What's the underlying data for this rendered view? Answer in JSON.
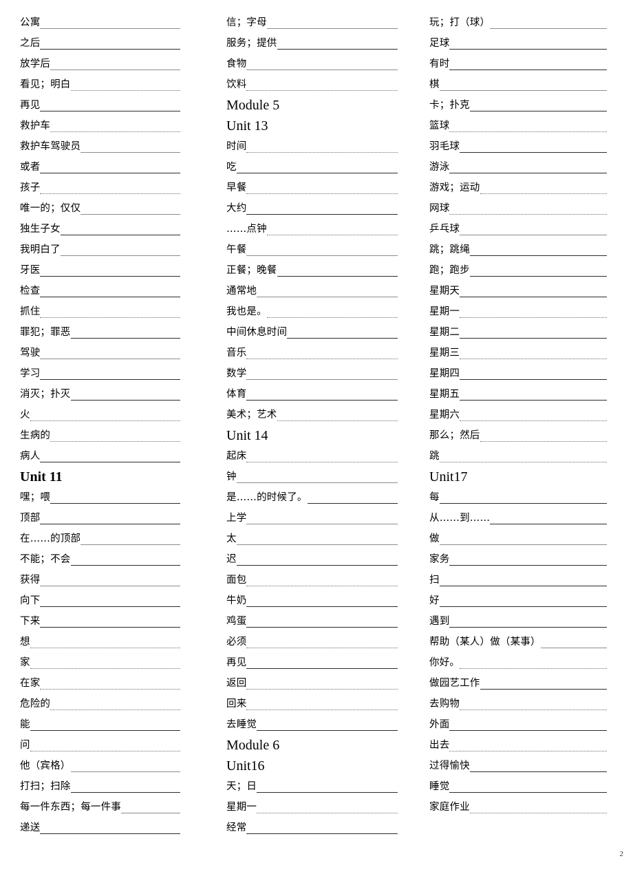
{
  "document": {
    "page_number": "2",
    "type": "vocabulary-worksheet"
  },
  "columns": [
    {
      "id": "column-1",
      "rows": [
        {
          "kind": "entry",
          "gloss": "公寓",
          "rule": "faint"
        },
        {
          "kind": "entry",
          "gloss": "之后",
          "rule": "solid"
        },
        {
          "kind": "entry",
          "gloss": "放学后",
          "rule": "faint"
        },
        {
          "kind": "entry",
          "gloss": "看见；明白",
          "rule": "dotted"
        },
        {
          "kind": "entry",
          "gloss": "再见",
          "rule": "solid"
        },
        {
          "kind": "entry",
          "gloss": "救护车",
          "rule": "dotted"
        },
        {
          "kind": "entry",
          "gloss": "救护车驾驶员",
          "rule": "faint"
        },
        {
          "kind": "entry",
          "gloss": "或者",
          "rule": "solid"
        },
        {
          "kind": "entry",
          "gloss": "孩子",
          "rule": "dotted"
        },
        {
          "kind": "entry",
          "gloss": "唯一的；仅仅",
          "rule": "faint"
        },
        {
          "kind": "entry",
          "gloss": "独生子女",
          "rule": "solid"
        },
        {
          "kind": "entry",
          "gloss": "我明白了",
          "rule": "faint"
        },
        {
          "kind": "entry",
          "gloss": "牙医",
          "rule": "solid"
        },
        {
          "kind": "entry",
          "gloss": "检查",
          "rule": "solid"
        },
        {
          "kind": "entry",
          "gloss": "抓住",
          "rule": "dotted"
        },
        {
          "kind": "entry",
          "gloss": "罪犯；罪恶",
          "rule": "solid"
        },
        {
          "kind": "entry",
          "gloss": "驾驶",
          "rule": "faint"
        },
        {
          "kind": "entry",
          "gloss": "学习",
          "rule": "solid"
        },
        {
          "kind": "entry",
          "gloss": "消灭；扑灭",
          "rule": "solid"
        },
        {
          "kind": "entry",
          "gloss": "火",
          "rule": "dotted"
        },
        {
          "kind": "entry",
          "gloss": "生病的",
          "rule": "dotted"
        },
        {
          "kind": "entry",
          "gloss": "病人",
          "rule": "solid"
        },
        {
          "kind": "heading",
          "text": "Unit 11",
          "bold": true
        },
        {
          "kind": "entry",
          "gloss": "嘿；喂",
          "rule": "solid"
        },
        {
          "kind": "entry",
          "gloss": "顶部",
          "rule": "solid"
        },
        {
          "kind": "entry",
          "gloss": "在……的顶部",
          "rule": "faint"
        },
        {
          "kind": "entry",
          "gloss": "不能；不会",
          "rule": "solid"
        },
        {
          "kind": "entry",
          "gloss": "获得",
          "rule": "faint"
        },
        {
          "kind": "entry",
          "gloss": "向下",
          "rule": "solid"
        },
        {
          "kind": "entry",
          "gloss": "下来",
          "rule": "solid"
        },
        {
          "kind": "entry",
          "gloss": "想",
          "rule": "dotted"
        },
        {
          "kind": "entry",
          "gloss": "家",
          "rule": "dotted"
        },
        {
          "kind": "entry",
          "gloss": "在家",
          "rule": "dotted"
        },
        {
          "kind": "entry",
          "gloss": "危险的",
          "rule": "dotted"
        },
        {
          "kind": "entry",
          "gloss": "能",
          "rule": "solid"
        },
        {
          "kind": "entry",
          "gloss": "问",
          "rule": "dotted"
        },
        {
          "kind": "entry",
          "gloss": "他（宾格）",
          "rule": "faint"
        },
        {
          "kind": "entry",
          "gloss": "打扫；扫除",
          "rule": "solid"
        },
        {
          "kind": "entry",
          "gloss": "每一件东西；每一件事",
          "rule": "faint"
        },
        {
          "kind": "entry",
          "gloss": "递送",
          "rule": "solid"
        }
      ]
    },
    {
      "id": "column-2",
      "rows": [
        {
          "kind": "entry",
          "gloss": "信；字母",
          "rule": "faint"
        },
        {
          "kind": "entry",
          "gloss": "服务；提供",
          "rule": "solid"
        },
        {
          "kind": "entry",
          "gloss": "食物",
          "rule": "faint"
        },
        {
          "kind": "entry",
          "gloss": "饮料",
          "rule": "dotted"
        },
        {
          "kind": "heading",
          "text": "Module 5",
          "bold": false
        },
        {
          "kind": "heading",
          "text": "Unit 13",
          "bold": false
        },
        {
          "kind": "entry",
          "gloss": "时间",
          "rule": "dotted"
        },
        {
          "kind": "entry",
          "gloss": "吃",
          "rule": "solid"
        },
        {
          "kind": "entry",
          "gloss": "早餐",
          "rule": "dotted"
        },
        {
          "kind": "entry",
          "gloss": "大约",
          "rule": "solid"
        },
        {
          "kind": "entry",
          "gloss": "……点钟",
          "rule": "dotted"
        },
        {
          "kind": "entry",
          "gloss": "午餐",
          "rule": "faint"
        },
        {
          "kind": "entry",
          "gloss": "正餐；晚餐",
          "rule": "solid"
        },
        {
          "kind": "entry",
          "gloss": "通常地",
          "rule": "faint"
        },
        {
          "kind": "entry",
          "gloss": "我也是。",
          "rule": "dotted"
        },
        {
          "kind": "entry",
          "gloss": "中间休息时间",
          "rule": "solid"
        },
        {
          "kind": "entry",
          "gloss": "音乐",
          "rule": "dotted"
        },
        {
          "kind": "entry",
          "gloss": "数学",
          "rule": "faint"
        },
        {
          "kind": "entry",
          "gloss": "体育",
          "rule": "solid"
        },
        {
          "kind": "entry",
          "gloss": "美术；艺术",
          "rule": "dotted"
        },
        {
          "kind": "heading",
          "text": "Unit 14",
          "bold": false
        },
        {
          "kind": "entry",
          "gloss": "起床",
          "rule": "dotted"
        },
        {
          "kind": "entry",
          "gloss": "钟",
          "rule": "faint"
        },
        {
          "kind": "entry",
          "gloss": "是……的时候了。",
          "rule": "solid"
        },
        {
          "kind": "entry",
          "gloss": "上学",
          "rule": "faint"
        },
        {
          "kind": "entry",
          "gloss": "太",
          "rule": "faint"
        },
        {
          "kind": "entry",
          "gloss": "迟",
          "rule": "solid"
        },
        {
          "kind": "entry",
          "gloss": "面包",
          "rule": "dotted"
        },
        {
          "kind": "entry",
          "gloss": "牛奶",
          "rule": "solid"
        },
        {
          "kind": "entry",
          "gloss": "鸡蛋",
          "rule": "solid"
        },
        {
          "kind": "entry",
          "gloss": "必须",
          "rule": "dotted"
        },
        {
          "kind": "entry",
          "gloss": "再见",
          "rule": "solid"
        },
        {
          "kind": "entry",
          "gloss": "返回",
          "rule": "dotted"
        },
        {
          "kind": "entry",
          "gloss": "回来",
          "rule": "dotted"
        },
        {
          "kind": "entry",
          "gloss": "去睡觉",
          "rule": "solid"
        },
        {
          "kind": "heading",
          "text": "Module 6",
          "bold": false
        },
        {
          "kind": "heading",
          "text": "Unit16",
          "bold": false
        },
        {
          "kind": "entry",
          "gloss": "天；日",
          "rule": "solid"
        },
        {
          "kind": "entry",
          "gloss": "星期一",
          "rule": "dotted"
        },
        {
          "kind": "entry",
          "gloss": "经常",
          "rule": "solid"
        }
      ]
    },
    {
      "id": "column-3",
      "rows": [
        {
          "kind": "entry",
          "gloss": "玩；打（球）",
          "rule": "faint"
        },
        {
          "kind": "entry",
          "gloss": "足球",
          "rule": "solid"
        },
        {
          "kind": "entry",
          "gloss": "有时",
          "rule": "solid"
        },
        {
          "kind": "entry",
          "gloss": "棋",
          "rule": "faint"
        },
        {
          "kind": "entry",
          "gloss": "卡；扑克",
          "rule": "solid"
        },
        {
          "kind": "entry",
          "gloss": "篮球",
          "rule": "dotted"
        },
        {
          "kind": "entry",
          "gloss": "羽毛球",
          "rule": "solid"
        },
        {
          "kind": "entry",
          "gloss": "游泳",
          "rule": "solid"
        },
        {
          "kind": "entry",
          "gloss": "游戏；运动",
          "rule": "dotted"
        },
        {
          "kind": "entry",
          "gloss": "网球",
          "rule": "dotted"
        },
        {
          "kind": "entry",
          "gloss": "乒乓球",
          "rule": "faint"
        },
        {
          "kind": "entry",
          "gloss": "跳；跳绳",
          "rule": "solid"
        },
        {
          "kind": "entry",
          "gloss": "跑；跑步",
          "rule": "solid"
        },
        {
          "kind": "entry",
          "gloss": "星期天",
          "rule": "solid"
        },
        {
          "kind": "entry",
          "gloss": "星期一",
          "rule": "dotted"
        },
        {
          "kind": "entry",
          "gloss": "星期二",
          "rule": "solid"
        },
        {
          "kind": "entry",
          "gloss": "星期三",
          "rule": "dotted"
        },
        {
          "kind": "entry",
          "gloss": "星期四",
          "rule": "solid"
        },
        {
          "kind": "entry",
          "gloss": "星期五",
          "rule": "solid"
        },
        {
          "kind": "entry",
          "gloss": "星期六",
          "rule": "dotted"
        },
        {
          "kind": "entry",
          "gloss": "那么；然后",
          "rule": "dotted"
        },
        {
          "kind": "entry",
          "gloss": "跳",
          "rule": "dotted"
        },
        {
          "kind": "heading",
          "text": "Unit17",
          "bold": false
        },
        {
          "kind": "entry",
          "gloss": "每",
          "rule": "solid"
        },
        {
          "kind": "entry",
          "gloss": "从……到……",
          "rule": "solid"
        },
        {
          "kind": "entry",
          "gloss": "做",
          "rule": "faint"
        },
        {
          "kind": "entry",
          "gloss": "家务",
          "rule": "solid"
        },
        {
          "kind": "entry",
          "gloss": "扫",
          "rule": "solid"
        },
        {
          "kind": "entry",
          "gloss": "好",
          "rule": "solid"
        },
        {
          "kind": "entry",
          "gloss": "遇到",
          "rule": "solid"
        },
        {
          "kind": "entry",
          "gloss": "帮助（某人）做（某事）",
          "rule": "faint"
        },
        {
          "kind": "entry",
          "gloss": "你好。",
          "rule": "dotted"
        },
        {
          "kind": "entry",
          "gloss": "做园艺工作",
          "rule": "solid"
        },
        {
          "kind": "entry",
          "gloss": "去购物",
          "rule": "dotted"
        },
        {
          "kind": "entry",
          "gloss": "外面",
          "rule": "solid"
        },
        {
          "kind": "entry",
          "gloss": "出去",
          "rule": "dotted"
        },
        {
          "kind": "entry",
          "gloss": "过得愉快",
          "rule": "solid"
        },
        {
          "kind": "entry",
          "gloss": "睡觉",
          "rule": "solid"
        },
        {
          "kind": "entry",
          "gloss": "家庭作业",
          "rule": "dotted"
        }
      ]
    }
  ]
}
